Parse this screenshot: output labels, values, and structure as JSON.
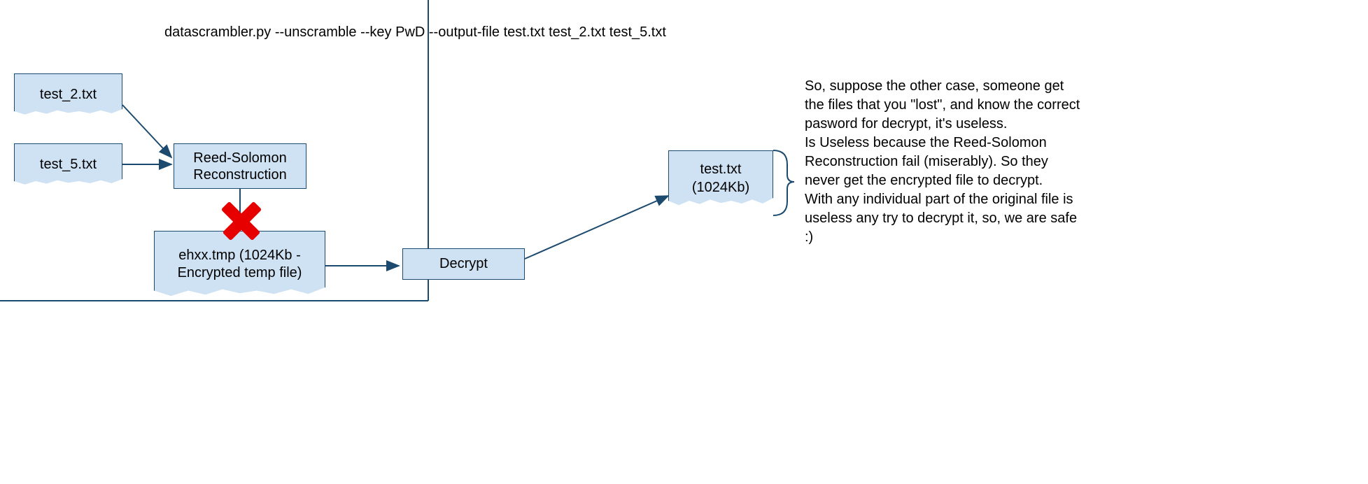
{
  "command_line": "datascrambler.py --unscramble --key PwD --output-file test.txt test_2.txt test_5.txt",
  "nodes": {
    "input1": {
      "label": "test_2.txt"
    },
    "input2": {
      "label": "test_5.txt"
    },
    "reed_solomon": {
      "label": "Reed-Solomon Reconstruction"
    },
    "encrypted_tmp": {
      "label": "ehxx.tmp (1024Kb - Encrypted temp file)"
    },
    "decrypt": {
      "label": "Decrypt"
    },
    "output": {
      "label": "test.txt (1024Kb)"
    }
  },
  "failure_marker": {
    "meaning": "Reed-Solomon reconstruction fails"
  },
  "annotation_text": "So, suppose the other case, someone get the files that you \"lost\", and know the correct pasword for decrypt, it's useless.\nIs Useless because the Reed-Solomon Reconstruction fail (miserably). So they never get the encrypted file to decrypt.\nWith any individual part of the original file is useless any try to decrypt it, so, we are safe :)",
  "colors": {
    "box_fill": "#cfe2f3",
    "box_stroke": "#1c4a6e",
    "arrow_stroke": "#1c4a6e",
    "fail_x": "#e60000"
  }
}
